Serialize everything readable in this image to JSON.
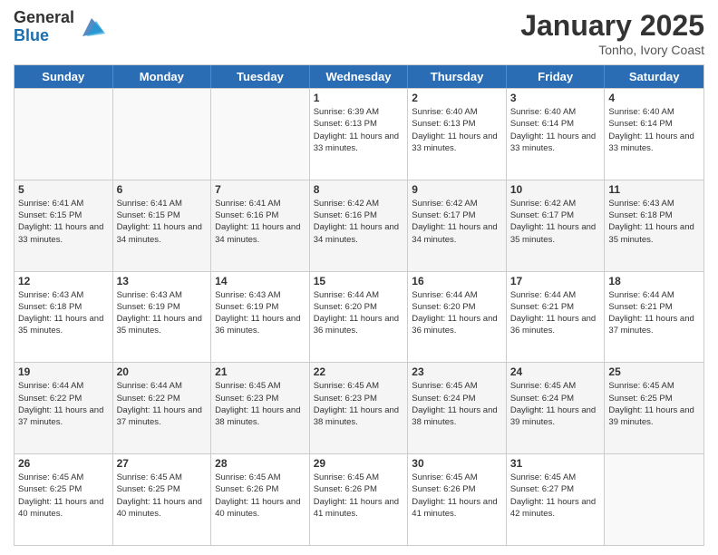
{
  "logo": {
    "general": "General",
    "blue": "Blue"
  },
  "title": "January 2025",
  "subtitle": "Tonho, Ivory Coast",
  "header_days": [
    "Sunday",
    "Monday",
    "Tuesday",
    "Wednesday",
    "Thursday",
    "Friday",
    "Saturday"
  ],
  "weeks": [
    [
      {
        "day": "",
        "sunrise": "",
        "sunset": "",
        "daylight": ""
      },
      {
        "day": "",
        "sunrise": "",
        "sunset": "",
        "daylight": ""
      },
      {
        "day": "",
        "sunrise": "",
        "sunset": "",
        "daylight": ""
      },
      {
        "day": "1",
        "sunrise": "Sunrise: 6:39 AM",
        "sunset": "Sunset: 6:13 PM",
        "daylight": "Daylight: 11 hours and 33 minutes."
      },
      {
        "day": "2",
        "sunrise": "Sunrise: 6:40 AM",
        "sunset": "Sunset: 6:13 PM",
        "daylight": "Daylight: 11 hours and 33 minutes."
      },
      {
        "day": "3",
        "sunrise": "Sunrise: 6:40 AM",
        "sunset": "Sunset: 6:14 PM",
        "daylight": "Daylight: 11 hours and 33 minutes."
      },
      {
        "day": "4",
        "sunrise": "Sunrise: 6:40 AM",
        "sunset": "Sunset: 6:14 PM",
        "daylight": "Daylight: 11 hours and 33 minutes."
      }
    ],
    [
      {
        "day": "5",
        "sunrise": "Sunrise: 6:41 AM",
        "sunset": "Sunset: 6:15 PM",
        "daylight": "Daylight: 11 hours and 33 minutes."
      },
      {
        "day": "6",
        "sunrise": "Sunrise: 6:41 AM",
        "sunset": "Sunset: 6:15 PM",
        "daylight": "Daylight: 11 hours and 34 minutes."
      },
      {
        "day": "7",
        "sunrise": "Sunrise: 6:41 AM",
        "sunset": "Sunset: 6:16 PM",
        "daylight": "Daylight: 11 hours and 34 minutes."
      },
      {
        "day": "8",
        "sunrise": "Sunrise: 6:42 AM",
        "sunset": "Sunset: 6:16 PM",
        "daylight": "Daylight: 11 hours and 34 minutes."
      },
      {
        "day": "9",
        "sunrise": "Sunrise: 6:42 AM",
        "sunset": "Sunset: 6:17 PM",
        "daylight": "Daylight: 11 hours and 34 minutes."
      },
      {
        "day": "10",
        "sunrise": "Sunrise: 6:42 AM",
        "sunset": "Sunset: 6:17 PM",
        "daylight": "Daylight: 11 hours and 35 minutes."
      },
      {
        "day": "11",
        "sunrise": "Sunrise: 6:43 AM",
        "sunset": "Sunset: 6:18 PM",
        "daylight": "Daylight: 11 hours and 35 minutes."
      }
    ],
    [
      {
        "day": "12",
        "sunrise": "Sunrise: 6:43 AM",
        "sunset": "Sunset: 6:18 PM",
        "daylight": "Daylight: 11 hours and 35 minutes."
      },
      {
        "day": "13",
        "sunrise": "Sunrise: 6:43 AM",
        "sunset": "Sunset: 6:19 PM",
        "daylight": "Daylight: 11 hours and 35 minutes."
      },
      {
        "day": "14",
        "sunrise": "Sunrise: 6:43 AM",
        "sunset": "Sunset: 6:19 PM",
        "daylight": "Daylight: 11 hours and 36 minutes."
      },
      {
        "day": "15",
        "sunrise": "Sunrise: 6:44 AM",
        "sunset": "Sunset: 6:20 PM",
        "daylight": "Daylight: 11 hours and 36 minutes."
      },
      {
        "day": "16",
        "sunrise": "Sunrise: 6:44 AM",
        "sunset": "Sunset: 6:20 PM",
        "daylight": "Daylight: 11 hours and 36 minutes."
      },
      {
        "day": "17",
        "sunrise": "Sunrise: 6:44 AM",
        "sunset": "Sunset: 6:21 PM",
        "daylight": "Daylight: 11 hours and 36 minutes."
      },
      {
        "day": "18",
        "sunrise": "Sunrise: 6:44 AM",
        "sunset": "Sunset: 6:21 PM",
        "daylight": "Daylight: 11 hours and 37 minutes."
      }
    ],
    [
      {
        "day": "19",
        "sunrise": "Sunrise: 6:44 AM",
        "sunset": "Sunset: 6:22 PM",
        "daylight": "Daylight: 11 hours and 37 minutes."
      },
      {
        "day": "20",
        "sunrise": "Sunrise: 6:44 AM",
        "sunset": "Sunset: 6:22 PM",
        "daylight": "Daylight: 11 hours and 37 minutes."
      },
      {
        "day": "21",
        "sunrise": "Sunrise: 6:45 AM",
        "sunset": "Sunset: 6:23 PM",
        "daylight": "Daylight: 11 hours and 38 minutes."
      },
      {
        "day": "22",
        "sunrise": "Sunrise: 6:45 AM",
        "sunset": "Sunset: 6:23 PM",
        "daylight": "Daylight: 11 hours and 38 minutes."
      },
      {
        "day": "23",
        "sunrise": "Sunrise: 6:45 AM",
        "sunset": "Sunset: 6:24 PM",
        "daylight": "Daylight: 11 hours and 38 minutes."
      },
      {
        "day": "24",
        "sunrise": "Sunrise: 6:45 AM",
        "sunset": "Sunset: 6:24 PM",
        "daylight": "Daylight: 11 hours and 39 minutes."
      },
      {
        "day": "25",
        "sunrise": "Sunrise: 6:45 AM",
        "sunset": "Sunset: 6:25 PM",
        "daylight": "Daylight: 11 hours and 39 minutes."
      }
    ],
    [
      {
        "day": "26",
        "sunrise": "Sunrise: 6:45 AM",
        "sunset": "Sunset: 6:25 PM",
        "daylight": "Daylight: 11 hours and 40 minutes."
      },
      {
        "day": "27",
        "sunrise": "Sunrise: 6:45 AM",
        "sunset": "Sunset: 6:25 PM",
        "daylight": "Daylight: 11 hours and 40 minutes."
      },
      {
        "day": "28",
        "sunrise": "Sunrise: 6:45 AM",
        "sunset": "Sunset: 6:26 PM",
        "daylight": "Daylight: 11 hours and 40 minutes."
      },
      {
        "day": "29",
        "sunrise": "Sunrise: 6:45 AM",
        "sunset": "Sunset: 6:26 PM",
        "daylight": "Daylight: 11 hours and 41 minutes."
      },
      {
        "day": "30",
        "sunrise": "Sunrise: 6:45 AM",
        "sunset": "Sunset: 6:26 PM",
        "daylight": "Daylight: 11 hours and 41 minutes."
      },
      {
        "day": "31",
        "sunrise": "Sunrise: 6:45 AM",
        "sunset": "Sunset: 6:27 PM",
        "daylight": "Daylight: 11 hours and 42 minutes."
      },
      {
        "day": "",
        "sunrise": "",
        "sunset": "",
        "daylight": ""
      }
    ]
  ]
}
